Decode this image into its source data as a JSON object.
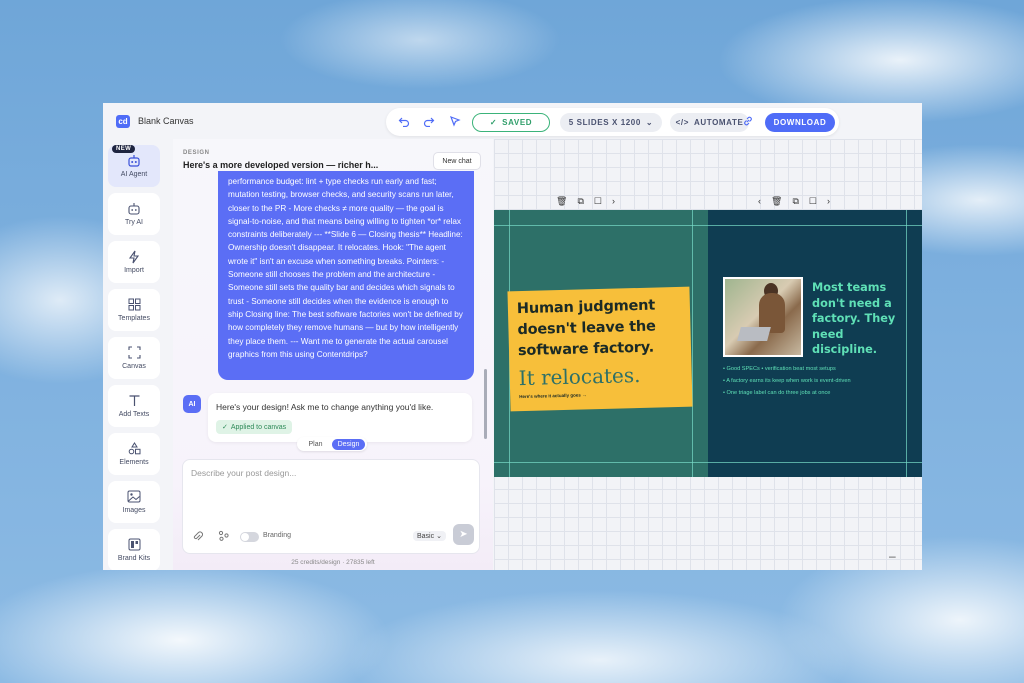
{
  "app": {
    "logo_text": "cd",
    "doc_title": "Blank Canvas"
  },
  "toolbar": {
    "saved_label": "SAVED",
    "slides_label": "5 SLIDES X 1200",
    "automate_label": "AUTOMATE",
    "download_label": "DOWNLOAD"
  },
  "sidebar": {
    "new_badge": "NEW",
    "items": [
      {
        "label": "AI Agent",
        "icon": "robot-icon"
      },
      {
        "label": "Try AI",
        "icon": "robot-outline-icon"
      },
      {
        "label": "Import",
        "icon": "lightning-icon"
      },
      {
        "label": "Templates",
        "icon": "grid-icon"
      },
      {
        "label": "Canvas",
        "icon": "frame-corners-icon"
      },
      {
        "label": "Add Texts",
        "icon": "text-t-icon"
      },
      {
        "label": "Elements",
        "icon": "shapes-icon"
      },
      {
        "label": "Images",
        "icon": "image-icon"
      },
      {
        "label": "Brand Kits",
        "icon": "brand-kit-icon"
      }
    ]
  },
  "chat": {
    "kicker": "DESIGN",
    "title": "Here's a more developed version — richer h...",
    "new_chat": "New chat",
    "user_message": "performance budget: lint + type checks run early and fast; mutation testing, browser checks, and security scans run later, closer to the PR - More checks ≠ more quality — the goal is signal-to-noise, and that means being willing to tighten *or* relax constraints deliberately --- **Slide 6 — Closing thesis** Headline: Ownership doesn't disappear. It relocates. Hook: \"The agent wrote it\" isn't an excuse when something breaks. Pointers: - Someone still chooses the problem and the architecture - Someone still sets the quality bar and decides which signals to trust - Someone still decides when the evidence is enough to ship Closing line: The best software factories won't be defined by how completely they remove humans — but by how intelligently they place them. --- Want me to generate the actual carousel graphics from this using Contentdrips?",
    "ai_avatar": "AI",
    "ai_message": "Here's your design! Ask me to change anything you'd like.",
    "applied_badge": "Applied to canvas",
    "mode_plan": "Plan",
    "mode_design": "Design",
    "composer_placeholder": "Describe your post design...",
    "branding_label": "Branding",
    "model_select": "Basic",
    "credits": "25 credits/design · 27835 left"
  },
  "canvas": {
    "slide1": {
      "headline": "Human judgment doesn't leave the software factory.",
      "serif_line": "It relocates.",
      "tiny_line": "Here's where it actually goes →"
    },
    "slide2": {
      "headline": "Most teams don't need a factory. They need discipline.",
      "bullets": [
        "• Good SPECs • verification beat most setups",
        "• A factory earns its keep when work is event-driven",
        "• One triage label can do three jobs at once"
      ]
    }
  },
  "colors": {
    "accent": "#4f6cf7",
    "slide1_bg": "#2d7068",
    "slide2_bg": "#0f3d52",
    "card_yellow": "#f7bf3a",
    "mint_text": "#5fe0b6"
  }
}
